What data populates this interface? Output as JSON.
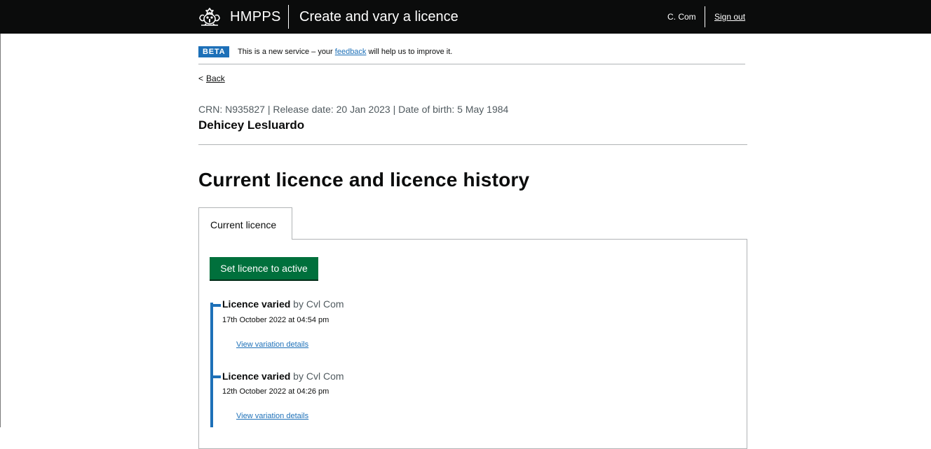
{
  "header": {
    "org": "HMPPS",
    "service": "Create and vary a licence",
    "user": "C. Com",
    "sign_out": "Sign out",
    "crest_icon": "royal-crest-icon"
  },
  "beta_banner": {
    "tag": "BETA",
    "text_before": "This is a new service – your ",
    "link": "feedback",
    "text_after": " will help us to improve it."
  },
  "back": {
    "chevron": "<",
    "label": "Back"
  },
  "person": {
    "meta": "CRN: N935827 | Release date: 20 Jan 2023 | Date of birth: 5 May 1984",
    "name": "Dehicey Lesluardo"
  },
  "page_title": "Current licence and licence history",
  "tabs": [
    {
      "label": "Current licence"
    }
  ],
  "actions": {
    "set_active": "Set licence to active"
  },
  "timeline": [
    {
      "title": "Licence varied",
      "by": " by Cvl Com",
      "date": "17th October 2022 at 04:54 pm",
      "link": "View variation details"
    },
    {
      "title": "Licence varied",
      "by": " by Cvl Com",
      "date": "12th October 2022 at 04:26 pm",
      "link": "View variation details"
    }
  ],
  "colors": {
    "header": "#0b0c0c",
    "link": "#1d70b8",
    "button": "#00703c",
    "tag": "#1d70b8"
  }
}
